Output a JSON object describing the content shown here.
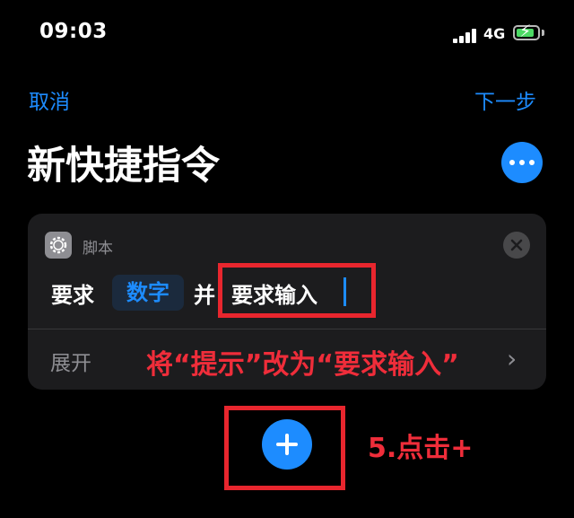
{
  "status_bar": {
    "time": "09:03",
    "network": "4G",
    "battery_level": 0.85
  },
  "nav": {
    "cancel_label": "取消",
    "next_label": "下一步"
  },
  "page": {
    "title": "新快捷指令"
  },
  "action_card": {
    "category_label": "脚本",
    "segment_require": "要求",
    "token_number": "数字",
    "segment_and": "并",
    "prompt_value": "要求输入",
    "expand_label": "展开",
    "chevron": "›"
  },
  "annotations": {
    "prompt_note": "将“提示”改为“要求输入”",
    "step_note": "5.点击+",
    "color": "#e8262e"
  },
  "colors": {
    "accent": "#1d8cff",
    "card_bg": "#1c1c1e",
    "background": "#000000"
  }
}
